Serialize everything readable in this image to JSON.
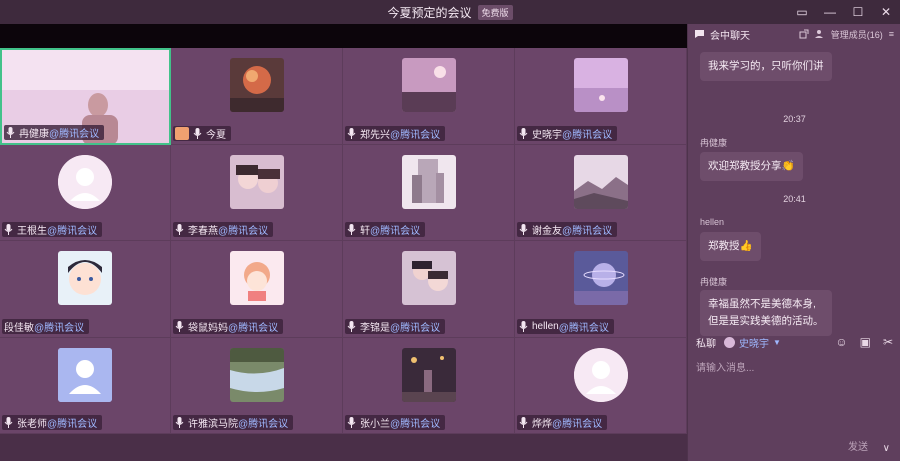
{
  "window": {
    "title": "今夏预定的会议",
    "badge": "免费版",
    "controls": {
      "pin": "▭",
      "min": "—",
      "max": "☐",
      "close": "✕"
    }
  },
  "grid": {
    "org_suffix": "@腾讯会议",
    "tiles": [
      {
        "name": "冉健康",
        "org": true,
        "avatar": "video-feed"
      },
      {
        "name": "今夏",
        "org": false,
        "avatar": "fire-photo",
        "self": true
      },
      {
        "name": "郑先兴",
        "org": true,
        "avatar": "sunset-photo"
      },
      {
        "name": "史晓宇",
        "org": true,
        "avatar": "pink-sky-photo"
      },
      {
        "name": "王根生",
        "org": true,
        "avatar": "default-person"
      },
      {
        "name": "李春燕",
        "org": true,
        "avatar": "selfie-photo"
      },
      {
        "name": "轩",
        "org": true,
        "avatar": "sculpture-photo"
      },
      {
        "name": "谢金友",
        "org": true,
        "avatar": "misty-landscape-photo"
      },
      {
        "name": "段佳敏",
        "org": true,
        "avatar": "anime-avatar"
      },
      {
        "name": "袋鼠妈妈",
        "org": true,
        "avatar": "cartoon-girl-avatar"
      },
      {
        "name": "李锦是",
        "org": true,
        "avatar": "family-photo"
      },
      {
        "name": "hellen",
        "org": true,
        "avatar": "planet-photo"
      },
      {
        "name": "张老师",
        "org": true,
        "avatar": "default-blue-person"
      },
      {
        "name": "许雅滨马院",
        "org": true,
        "avatar": "river-photo"
      },
      {
        "name": "张小兰",
        "org": true,
        "avatar": "night-photo"
      },
      {
        "name": "烨烨",
        "org": true,
        "avatar": "default-person"
      }
    ]
  },
  "chat": {
    "title": "会中聊天",
    "manage_label": "管理成员(16)",
    "messages": {
      "m1": "我来学习的，只听你们讲",
      "t1": "20:37",
      "s2": "冉健康",
      "m2": "欢迎郑教授分享👏",
      "t2": "20:41",
      "s3": "hellen",
      "m3": "郑教授👍",
      "s4": "冉健康",
      "m4a": "幸福虽然不是美德本身,",
      "m4b": "但是是实践美德的活动。"
    },
    "private_label": "私聊",
    "private_target": "史晓宇",
    "input_placeholder": "请输入消息...",
    "send_label": "发送"
  },
  "colors": {
    "accent": "#42c28a",
    "org_link": "#9fb8ff"
  }
}
